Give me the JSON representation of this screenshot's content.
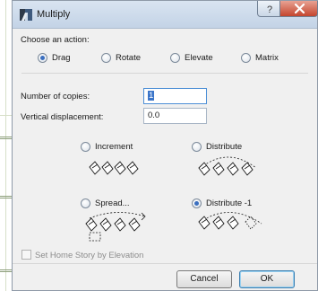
{
  "dialog": {
    "title": "Multiply"
  },
  "action": {
    "label": "Choose an action:",
    "options": [
      "Drag",
      "Rotate",
      "Elevate",
      "Matrix"
    ],
    "selected": "Drag"
  },
  "fields": {
    "copies_label": "Number of copies:",
    "copies_value": "1",
    "vertical_label": "Vertical displacement:",
    "vertical_value": "0.0"
  },
  "distribution": {
    "options": [
      "Increment",
      "Distribute",
      "Spread...",
      "Distribute -1"
    ],
    "selected": "Distribute -1"
  },
  "home_story": {
    "label": "Set Home Story by Elevation",
    "checked": false,
    "enabled": false
  },
  "buttons": {
    "cancel": "Cancel",
    "ok": "OK"
  },
  "colors": {
    "title_bar": "#c9d8ea",
    "dialog_bg": "#f0f0f0",
    "close_button": "#c4452e",
    "radio_dot": "#3b6fbf",
    "selection": "#3b75c9"
  },
  "icons": {
    "app": "multiply-icon",
    "help": "question-mark-icon",
    "close": "close-x-icon"
  }
}
